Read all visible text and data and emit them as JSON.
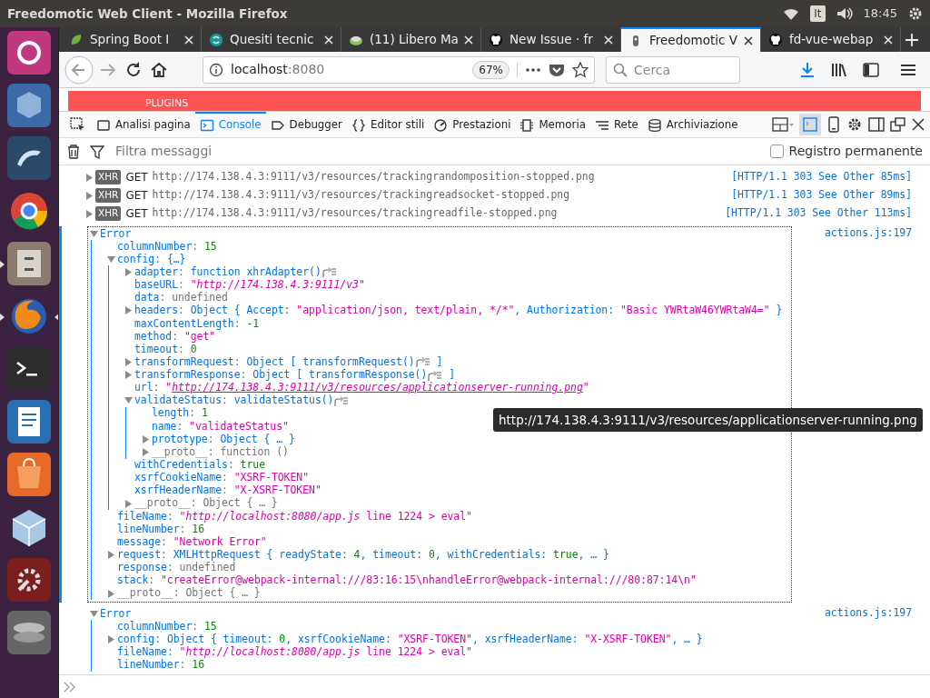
{
  "window": {
    "title": "Freedomotic Web Client - Mozilla Firefox"
  },
  "tray": {
    "keyboard": "It",
    "clock": "18:45"
  },
  "launcher": [
    {
      "kind": "ubuntu",
      "running": false,
      "focused": false
    },
    {
      "kind": "vbox",
      "running": false,
      "focused": false
    },
    {
      "kind": "dolphin",
      "running": false,
      "focused": false
    },
    {
      "kind": "chrome",
      "running": false,
      "focused": false
    },
    {
      "kind": "cabinet",
      "running": true,
      "focused": false
    },
    {
      "kind": "firefox",
      "running": true,
      "focused": true
    },
    {
      "kind": "terminal",
      "running": false,
      "focused": false
    },
    {
      "kind": "writer",
      "running": false,
      "focused": false
    },
    {
      "kind": "store",
      "running": false,
      "focused": false
    },
    {
      "kind": "cube",
      "running": false,
      "focused": false
    },
    {
      "kind": "settings",
      "running": false,
      "focused": false
    },
    {
      "kind": "disk",
      "running": false,
      "focused": false
    }
  ],
  "tabs": [
    {
      "kind": "leaf",
      "label": "Spring Boot I",
      "selected": false
    },
    {
      "kind": "swirl",
      "label": "Quesiti tecnic",
      "selected": false
    },
    {
      "kind": "disc",
      "label": "(11) Libero Ma",
      "selected": false
    },
    {
      "kind": "octo",
      "label": "New Issue · fr",
      "selected": false
    },
    {
      "kind": "plug",
      "label": "Freedomotic V",
      "selected": true
    },
    {
      "kind": "octo",
      "label": "fd-vue-webap",
      "selected": false
    }
  ],
  "address_bar": {
    "host": "localhost",
    "port": ":8080",
    "zoom": "67%"
  },
  "search": {
    "placeholder": "Cerca"
  },
  "page": {
    "header_label": "PLUGINS"
  },
  "devtools": {
    "tabs": [
      {
        "kind": "inspector",
        "label": "Analisi pagina",
        "selected": false
      },
      {
        "kind": "console",
        "label": "Console",
        "selected": true
      },
      {
        "kind": "debugger",
        "label": "Debugger",
        "selected": false
      },
      {
        "kind": "braces",
        "label": "Editor stili",
        "selected": false
      },
      {
        "kind": "gauge",
        "label": "Prestazioni",
        "selected": false
      },
      {
        "kind": "chip",
        "label": "Memoria",
        "selected": false
      },
      {
        "kind": "lines",
        "label": "Rete",
        "selected": false
      },
      {
        "kind": "db",
        "label": "Archiviazione",
        "selected": false
      }
    ],
    "filter": {
      "placeholder": "Filtra messaggi"
    },
    "persist": {
      "label": "Registro permanente",
      "checked": false
    }
  },
  "requests": [
    {
      "badge": "XHR",
      "method": "GET",
      "url": "http://174.138.4.3:9111/v3/resources/trackingrandomposition-stopped.png",
      "status": "[HTTP/1.1 303 See Other 85ms]"
    },
    {
      "badge": "XHR",
      "method": "GET",
      "url": "http://174.138.4.3:9111/v3/resources/trackingreadsocket-stopped.png",
      "status": "[HTTP/1.1 303 See Other 89ms]"
    },
    {
      "badge": "XHR",
      "method": "GET",
      "url": "http://174.138.4.3:9111/v3/resources/trackingreadfile-stopped.png",
      "status": "[HTTP/1.1 303 See Other 113ms]"
    }
  ],
  "errors": [
    {
      "title": "Error",
      "source": "actions.js:197",
      "selected": true,
      "expanded": true,
      "children": [
        {
          "segments": [
            {
              "kind": "key",
              "text": "columnNumber"
            },
            {
              "kind": "punct",
              "text": ": "
            },
            {
              "kind": "number",
              "text": "15"
            }
          ]
        },
        {
          "expanded": true,
          "segments": [
            {
              "kind": "key",
              "text": "config"
            },
            {
              "kind": "punct",
              "text": ": "
            },
            {
              "kind": "ident",
              "text": "{…}"
            }
          ],
          "children": [
            {
              "expanded": false,
              "segments": [
                {
                  "kind": "key",
                  "text": "adapter"
                },
                {
                  "kind": "punct",
                  "text": ": "
                },
                {
                  "kind": "ident",
                  "text": "function xhrAdapter()"
                },
                {
                  "kind": "jump"
                }
              ]
            },
            {
              "segments": [
                {
                  "kind": "key",
                  "text": "baseURL"
                },
                {
                  "kind": "punct",
                  "text": ": "
                },
                {
                  "kind": "string",
                  "text": "\""
                },
                {
                  "kind": "italic",
                  "text": "http://174.138.4.3:9111/v3"
                },
                {
                  "kind": "string",
                  "text": "\""
                }
              ]
            },
            {
              "segments": [
                {
                  "kind": "key",
                  "text": "data"
                },
                {
                  "kind": "punct",
                  "text": ": "
                },
                {
                  "kind": "muted",
                  "text": "undefined"
                }
              ]
            },
            {
              "expanded": false,
              "segments": [
                {
                  "kind": "key",
                  "text": "headers"
                },
                {
                  "kind": "punct",
                  "text": ": "
                },
                {
                  "kind": "ident",
                  "text": "Object { Accept: "
                },
                {
                  "kind": "string",
                  "text": "\"application/json, text/plain, */*\""
                },
                {
                  "kind": "ident",
                  "text": ", Authorization: "
                },
                {
                  "kind": "string",
                  "text": "\"Basic YWRtaW46YWRtaW4=\""
                },
                {
                  "kind": "ident",
                  "text": " }"
                }
              ]
            },
            {
              "segments": [
                {
                  "kind": "key",
                  "text": "maxContentLength"
                },
                {
                  "kind": "punct",
                  "text": ": "
                },
                {
                  "kind": "number",
                  "text": "-1"
                }
              ]
            },
            {
              "segments": [
                {
                  "kind": "key",
                  "text": "method"
                },
                {
                  "kind": "punct",
                  "text": ": "
                },
                {
                  "kind": "string",
                  "text": "\"get\""
                }
              ]
            },
            {
              "segments": [
                {
                  "kind": "key",
                  "text": "timeout"
                },
                {
                  "kind": "punct",
                  "text": ": "
                },
                {
                  "kind": "number",
                  "text": "0"
                }
              ]
            },
            {
              "expanded": false,
              "segments": [
                {
                  "kind": "key",
                  "text": "transformRequest"
                },
                {
                  "kind": "punct",
                  "text": ": "
                },
                {
                  "kind": "ident",
                  "text": "Object [ transformRequest()"
                },
                {
                  "kind": "jump"
                },
                {
                  "kind": "ident",
                  "text": " ]"
                }
              ]
            },
            {
              "expanded": false,
              "segments": [
                {
                  "kind": "key",
                  "text": "transformResponse"
                },
                {
                  "kind": "punct",
                  "text": ": "
                },
                {
                  "kind": "ident",
                  "text": "Object [ transformResponse()"
                },
                {
                  "kind": "jump"
                },
                {
                  "kind": "ident",
                  "text": " ]"
                }
              ]
            },
            {
              "segments": [
                {
                  "kind": "key",
                  "text": "url"
                },
                {
                  "kind": "punct",
                  "text": ": "
                },
                {
                  "kind": "string",
                  "text": "\""
                },
                {
                  "kind": "link",
                  "text": "http://174.138.4.3:9111/v3/resources/applicationserver-running.png"
                },
                {
                  "kind": "string",
                  "text": "\""
                }
              ]
            },
            {
              "expanded": true,
              "segments": [
                {
                  "kind": "key",
                  "text": "validateStatus"
                },
                {
                  "kind": "punct",
                  "text": ": "
                },
                {
                  "kind": "ident",
                  "text": "validateStatus()"
                },
                {
                  "kind": "jump"
                }
              ],
              "children": [
                {
                  "segments": [
                    {
                      "kind": "key",
                      "text": "length"
                    },
                    {
                      "kind": "punct",
                      "text": ": "
                    },
                    {
                      "kind": "number",
                      "text": "1"
                    }
                  ]
                },
                {
                  "segments": [
                    {
                      "kind": "key",
                      "text": "name"
                    },
                    {
                      "kind": "punct",
                      "text": ": "
                    },
                    {
                      "kind": "string",
                      "text": "\"validateStatus\""
                    }
                  ]
                },
                {
                  "expanded": false,
                  "segments": [
                    {
                      "kind": "key",
                      "text": "prototype"
                    },
                    {
                      "kind": "punct",
                      "text": ": "
                    },
                    {
                      "kind": "ident",
                      "text": "Object { … }"
                    }
                  ]
                },
                {
                  "expanded": false,
                  "segments": [
                    {
                      "kind": "muted",
                      "text": "__proto__: function ()"
                    }
                  ]
                }
              ]
            },
            {
              "segments": [
                {
                  "kind": "key",
                  "text": "withCredentials"
                },
                {
                  "kind": "punct",
                  "text": ": "
                },
                {
                  "kind": "number",
                  "text": "true"
                }
              ]
            },
            {
              "segments": [
                {
                  "kind": "key",
                  "text": "xsrfCookieName"
                },
                {
                  "kind": "punct",
                  "text": ": "
                },
                {
                  "kind": "string",
                  "text": "\"XSRF-TOKEN\""
                }
              ]
            },
            {
              "segments": [
                {
                  "kind": "key",
                  "text": "xsrfHeaderName"
                },
                {
                  "kind": "punct",
                  "text": ": "
                },
                {
                  "kind": "string",
                  "text": "\"X-XSRF-TOKEN\""
                }
              ]
            },
            {
              "expanded": false,
              "segments": [
                {
                  "kind": "muted",
                  "text": "__proto__: Object { … }"
                }
              ]
            }
          ]
        },
        {
          "segments": [
            {
              "kind": "key",
              "text": "fileName"
            },
            {
              "kind": "punct",
              "text": ": "
            },
            {
              "kind": "string",
              "text": "\""
            },
            {
              "kind": "italic",
              "text": "http://localhost:8080/app.js"
            },
            {
              "kind": "string",
              "text": " line 1224 > eval\""
            }
          ]
        },
        {
          "segments": [
            {
              "kind": "key",
              "text": "lineNumber"
            },
            {
              "kind": "punct",
              "text": ": "
            },
            {
              "kind": "number",
              "text": "16"
            }
          ]
        },
        {
          "segments": [
            {
              "kind": "key",
              "text": "message"
            },
            {
              "kind": "punct",
              "text": ": "
            },
            {
              "kind": "string",
              "text": "\"Network Error\""
            }
          ]
        },
        {
          "expanded": false,
          "segments": [
            {
              "kind": "key",
              "text": "request"
            },
            {
              "kind": "punct",
              "text": ": "
            },
            {
              "kind": "ident",
              "text": "XMLHttpRequest { readyState: "
            },
            {
              "kind": "number",
              "text": "4"
            },
            {
              "kind": "ident",
              "text": ", timeout: "
            },
            {
              "kind": "number",
              "text": "0"
            },
            {
              "kind": "ident",
              "text": ", withCredentials: "
            },
            {
              "kind": "number",
              "text": "true"
            },
            {
              "kind": "ident",
              "text": ", … }"
            }
          ]
        },
        {
          "segments": [
            {
              "kind": "key",
              "text": "response"
            },
            {
              "kind": "punct",
              "text": ": "
            },
            {
              "kind": "muted",
              "text": "undefined"
            }
          ]
        },
        {
          "segments": [
            {
              "kind": "key",
              "text": "stack"
            },
            {
              "kind": "punct",
              "text": ": "
            },
            {
              "kind": "string",
              "text": "\"createError@webpack-internal:///83:16:15\\nhandleError@webpack-internal:///80:87:14\\n\""
            }
          ]
        },
        {
          "expanded": false,
          "segments": [
            {
              "kind": "muted",
              "text": "__proto__: Object { … }"
            }
          ]
        }
      ]
    },
    {
      "title": "Error",
      "source": "actions.js:197",
      "selected": false,
      "expanded": true,
      "children": [
        {
          "segments": [
            {
              "kind": "key",
              "text": "columnNumber"
            },
            {
              "kind": "punct",
              "text": ": "
            },
            {
              "kind": "number",
              "text": "15"
            }
          ]
        },
        {
          "expanded": false,
          "segments": [
            {
              "kind": "key",
              "text": "config"
            },
            {
              "kind": "punct",
              "text": ": "
            },
            {
              "kind": "ident",
              "text": "Object { timeout: "
            },
            {
              "kind": "number",
              "text": "0"
            },
            {
              "kind": "ident",
              "text": ", xsrfCookieName: "
            },
            {
              "kind": "string",
              "text": "\"XSRF-TOKEN\""
            },
            {
              "kind": "ident",
              "text": ", xsrfHeaderName: "
            },
            {
              "kind": "string",
              "text": "\"X-XSRF-TOKEN\""
            },
            {
              "kind": "ident",
              "text": ", … }"
            }
          ]
        },
        {
          "segments": [
            {
              "kind": "key",
              "text": "fileName"
            },
            {
              "kind": "punct",
              "text": ": "
            },
            {
              "kind": "string",
              "text": "\""
            },
            {
              "kind": "italic",
              "text": "http://localhost:8080/app.js"
            },
            {
              "kind": "string",
              "text": " line 1224 > eval\""
            }
          ]
        },
        {
          "segments": [
            {
              "kind": "key",
              "text": "lineNumber"
            },
            {
              "kind": "punct",
              "text": ": "
            },
            {
              "kind": "number",
              "text": "16"
            }
          ]
        }
      ]
    }
  ],
  "tooltip": {
    "text": "http://174.138.4.3:9111/v3/resources/applicationserver-running.png"
  }
}
